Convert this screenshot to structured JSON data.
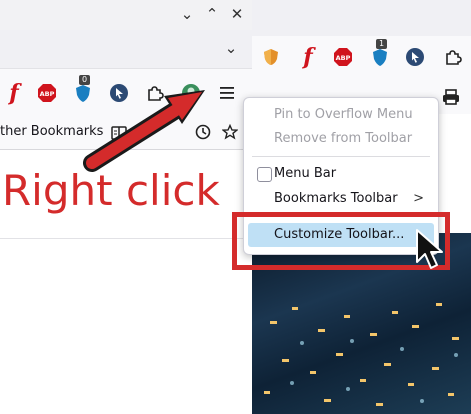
{
  "left_window": {
    "controls": {
      "minimize": "⌄",
      "maximize": "⌃",
      "close": "✕"
    },
    "list_all_tabs": "⌄",
    "toolbar": {
      "ublock_badge": "0"
    },
    "bookmarks_bar": {
      "other_bookmarks": "ther Bookmarks"
    }
  },
  "right_window": {
    "ublock_badge": "1"
  },
  "context_menu": {
    "items": [
      {
        "label": "Pin to Overflow Menu",
        "disabled": true
      },
      {
        "label": "Remove from Toolbar",
        "disabled": true
      },
      {
        "label": "Menu Bar",
        "checkbox": true,
        "checked": false
      },
      {
        "label": "Bookmarks Toolbar",
        "submenu": true
      },
      {
        "label": "Customize Toolbar...",
        "highlighted": true
      }
    ],
    "submenu_arrow": ">"
  },
  "annotation": {
    "text": "Right click",
    "color": "#d42b2b"
  },
  "colors": {
    "highlight": "#bfe0f5",
    "annotation_red": "#d42b2b"
  }
}
